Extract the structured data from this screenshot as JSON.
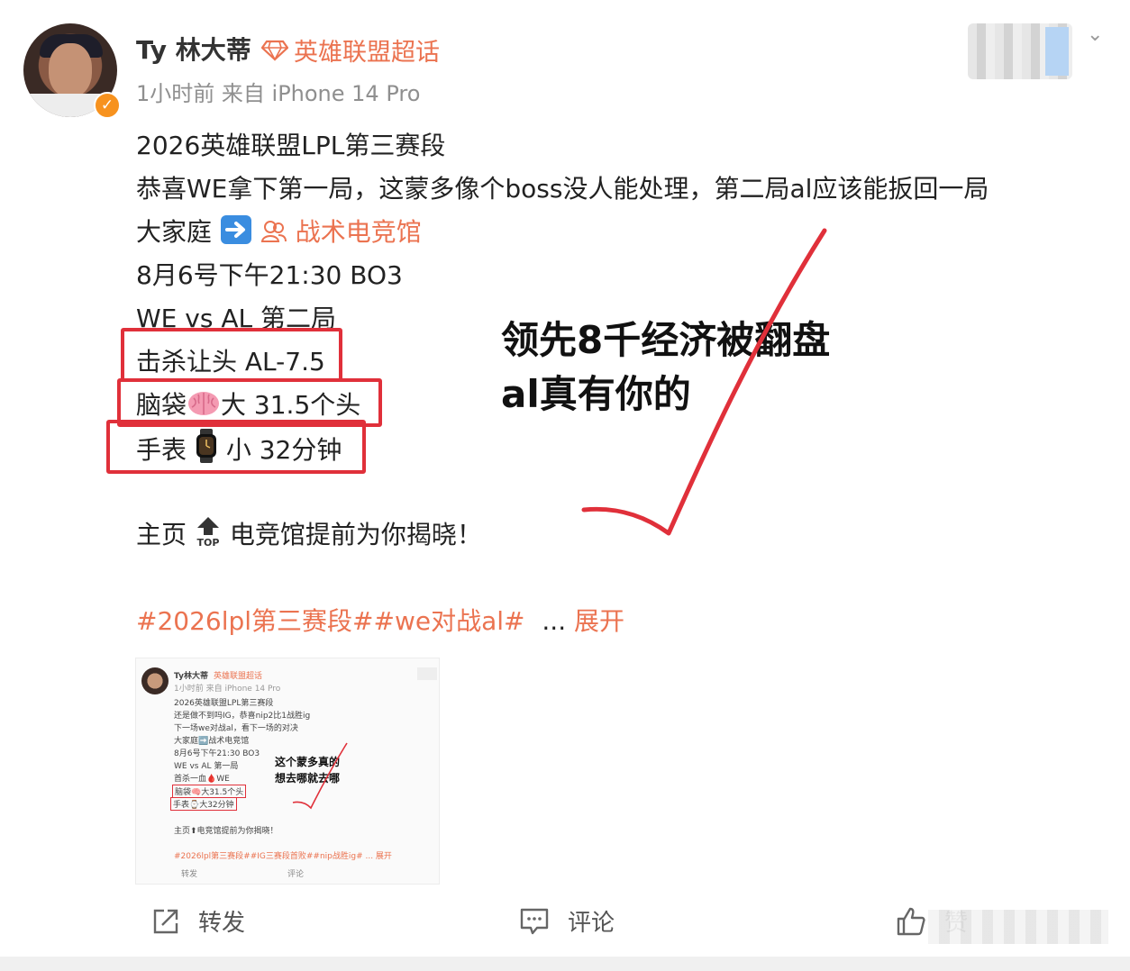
{
  "header": {
    "username": "Ty 林大蒂",
    "topic": "英雄联盟超话",
    "meta": "1小时前  来自 iPhone 14 Pro"
  },
  "post": {
    "lines": [
      "2026英雄联盟LPL第三赛段",
      "恭喜WE拿下第一局，这蒙多像个boss没人能处理，第二局al应该能扳回一局",
      "大家庭",
      "战术电竞馆",
      "8月6号下午21:30 BO3",
      "WE vs AL 第二局"
    ],
    "boxed": {
      "kill_handicap": "击杀让头 AL-7.5",
      "brain_label": "脑袋",
      "brain_value": "大 31.5个头",
      "watch_label": "手表",
      "watch_value": "小 32分钟"
    },
    "homepage_line_a": "主页",
    "homepage_line_b": "电竞馆提前为你揭晓！",
    "hashtags": "#2026lpl第三赛段##we对战al#",
    "ellipsis": "...",
    "expand": "展开"
  },
  "annotation": {
    "line1": "领先8千经济被翻盘",
    "line2": "al真有你的"
  },
  "thumbnail": {
    "username": "Ty林大蒂",
    "topic": "英雄联盟超话",
    "meta": "1小时前 来自 iPhone 14 Pro",
    "lines": [
      "2026英雄联盟LPL第三赛段",
      "还是做不到吗IG，恭喜nip2比1战胜ig",
      "下一场we对战al，看下一场的对决",
      "大家庭➡️战术电竞馆",
      "8月6号下午21:30 BO3",
      "WE vs AL 第一局",
      "首杀一血🩸WE",
      "脑袋🧠大31.5个头",
      "手表⌚大32分钟",
      "主页⬆电竞馆提前为你揭晓！",
      "#2026lpl第三赛段##IG三赛段首败##nip战胜ig#  ... 展开"
    ],
    "note1": "这个蒙多真的",
    "note2": "想去哪就去哪",
    "repost": "转发",
    "comment": "评论"
  },
  "actions": {
    "repost": "转发",
    "comment": "评论",
    "like": "赞"
  },
  "colors": {
    "accent": "#eb7350",
    "verified": "#f7921e",
    "red_annotation": "#e0303a"
  }
}
